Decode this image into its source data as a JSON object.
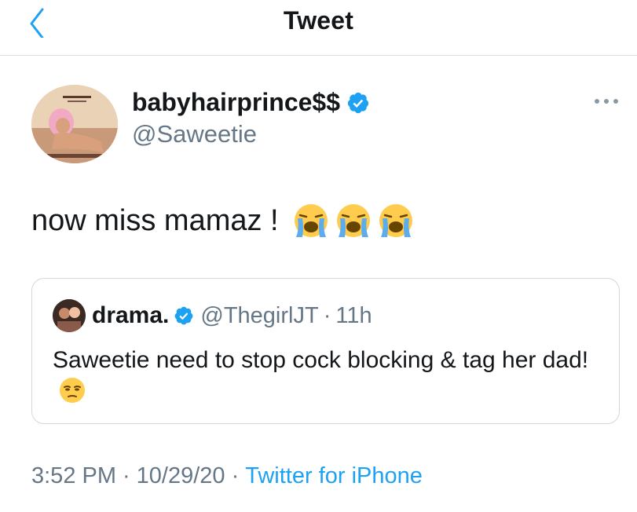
{
  "header": {
    "title": "Tweet",
    "back_icon": "chevron-left-icon"
  },
  "author": {
    "name": "babyhairprince$$",
    "handle": "@Saweetie",
    "verified_icon": "verified-badge-icon"
  },
  "tweet": {
    "text": "now miss mamaz !",
    "emojis": [
      "loudly-crying-face",
      "loudly-crying-face",
      "loudly-crying-face"
    ]
  },
  "quoted_tweet": {
    "author_name": "drama.",
    "author_handle": "@ThegirlJT",
    "separator": "·",
    "time": "11h",
    "text": "Saweetie need to stop cock blocking & tag her dad!",
    "emoji": "unamused-face"
  },
  "meta": {
    "time": "3:52 PM",
    "date": "10/29/20",
    "source": "Twitter for iPhone",
    "separator": "·"
  },
  "colors": {
    "accent": "#1da1f2",
    "muted_text": "#657786",
    "border": "#cfd9de",
    "text": "#14171a"
  }
}
